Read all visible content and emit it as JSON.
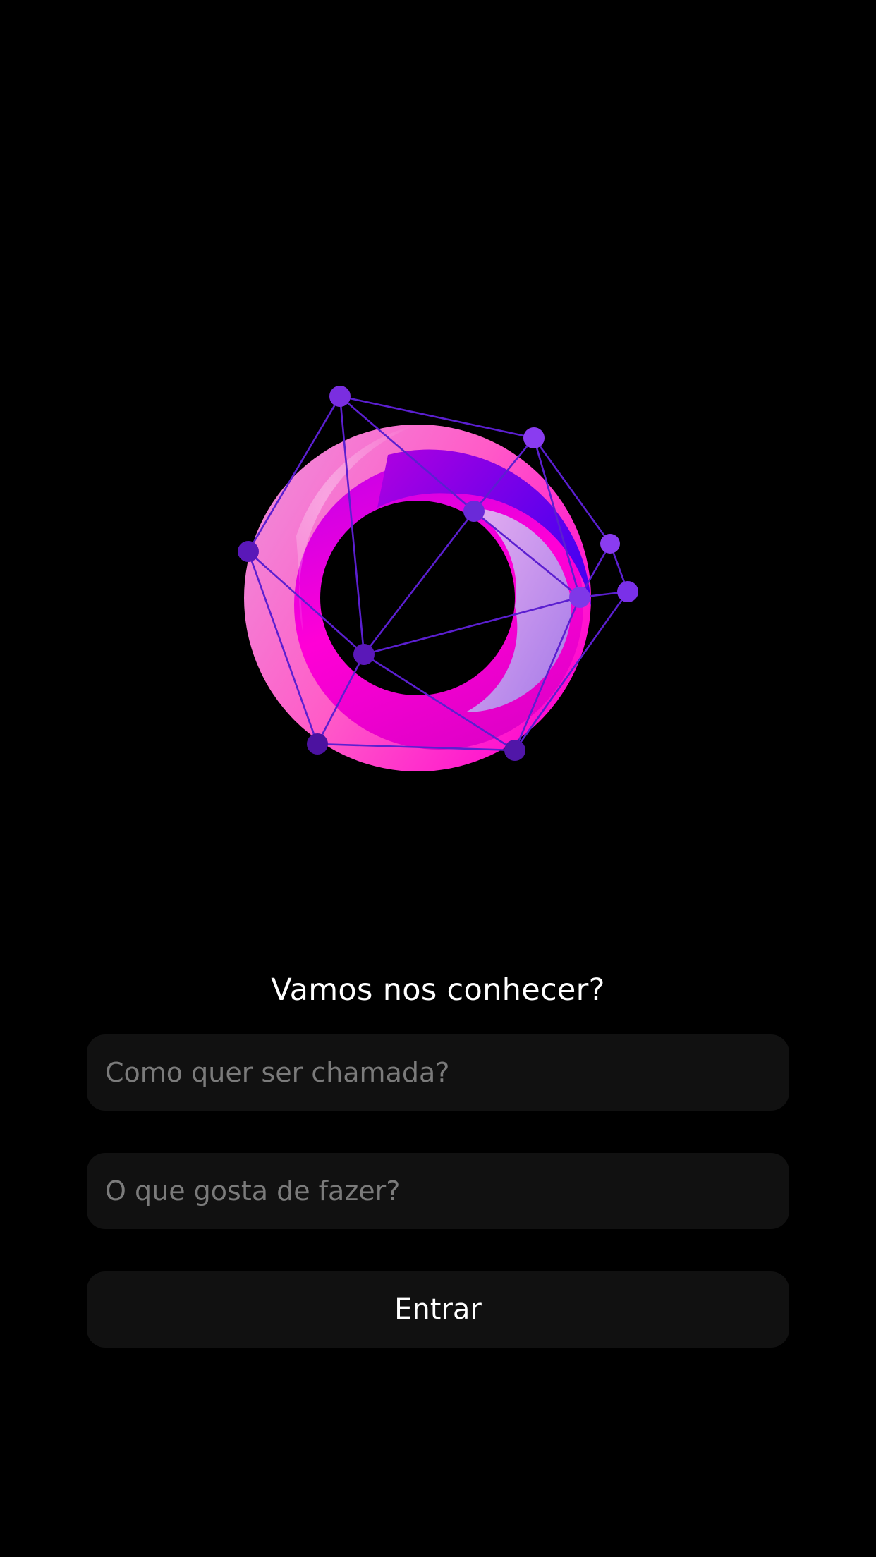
{
  "logo": {
    "icon": "network-ring-logo-icon",
    "colors": {
      "pink": "#ff5fb0",
      "magenta": "#ff00d8",
      "violet": "#6a00f0",
      "lavender": "#c89aee",
      "node": "#6a2ad8",
      "edge": "#5b1fd0"
    }
  },
  "welcome": {
    "title": "Vamos nos conhecer?"
  },
  "form": {
    "name_placeholder": "Como quer ser chamada?",
    "name_value": "",
    "hobby_placeholder": "O que gosta de fazer?",
    "hobby_value": "",
    "submit_label": "Entrar"
  }
}
